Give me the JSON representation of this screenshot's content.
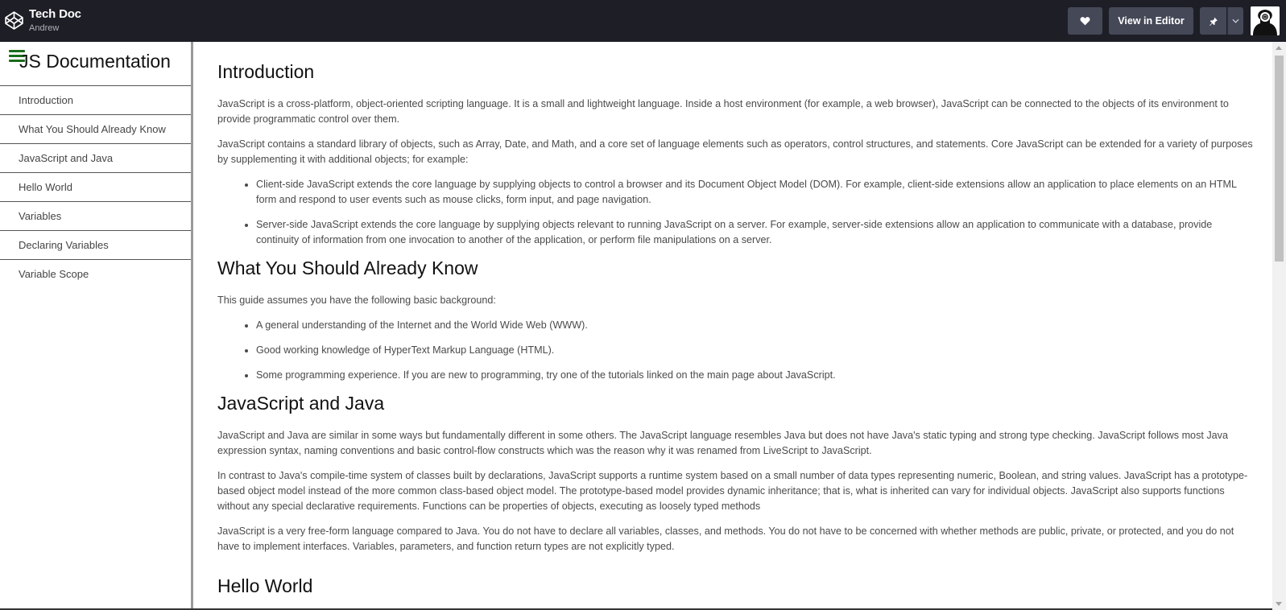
{
  "topbar": {
    "brand_title": "Tech Doc",
    "brand_user": "Andrew",
    "logo_icon": "codepen-logo-icon",
    "heart_icon": "heart-icon",
    "view_in_editor_label": "View in Editor",
    "pin_icon": "pin-icon",
    "caret_icon": "chevron-down-icon",
    "avatar_icon": "user-avatar-icon"
  },
  "sidebar": {
    "title": "JS Documentation",
    "menu_icon": "hamburger-menu-icon",
    "items": [
      {
        "label": "Introduction"
      },
      {
        "label": "What You Should Already Know"
      },
      {
        "label": "JavaScript and Java"
      },
      {
        "label": "Hello World"
      },
      {
        "label": "Variables"
      },
      {
        "label": "Declaring Variables"
      },
      {
        "label": "Variable Scope"
      }
    ]
  },
  "main": {
    "sections": [
      {
        "title": "Introduction",
        "paragraphs": [
          "JavaScript is a cross-platform, object-oriented scripting language. It is a small and lightweight language. Inside a host environment (for example, a web browser), JavaScript can be connected to the objects of its environment to provide programmatic control over them.",
          "JavaScript contains a standard library of objects, such as Array, Date, and Math, and a core set of language elements such as operators, control structures, and statements. Core JavaScript can be extended for a variety of purposes by supplementing it with additional objects; for example:"
        ],
        "bullets": [
          "Client-side JavaScript extends the core language by supplying objects to control a browser and its Document Object Model (DOM). For example, client-side extensions allow an application to place elements on an HTML form and respond to user events such as mouse clicks, form input, and page navigation.",
          "Server-side JavaScript extends the core language by supplying objects relevant to running JavaScript on a server. For example, server-side extensions allow an application to communicate with a database, provide continuity of information from one invocation to another of the application, or perform file manipulations on a server."
        ]
      },
      {
        "title": "What You Should Already Know",
        "paragraphs": [
          "This guide assumes you have the following basic background:"
        ],
        "bullets": [
          "A general understanding of the Internet and the World Wide Web (WWW).",
          "Good working knowledge of HyperText Markup Language (HTML).",
          "Some programming experience. If you are new to programming, try one of the tutorials linked on the main page about JavaScript."
        ]
      },
      {
        "title": "JavaScript and Java",
        "paragraphs": [
          "JavaScript and Java are similar in some ways but fundamentally different in some others. The JavaScript language resembles Java but does not have Java's static typing and strong type checking. JavaScript follows most Java expression syntax, naming conventions and basic control-flow constructs which was the reason why it was renamed from LiveScript to JavaScript.",
          "In contrast to Java's compile-time system of classes built by declarations, JavaScript supports a runtime system based on a small number of data types representing numeric, Boolean, and string values. JavaScript has a prototype-based object model instead of the more common class-based object model. The prototype-based model provides dynamic inheritance; that is, what is inherited can vary for individual objects. JavaScript also supports functions without any special declarative requirements. Functions can be properties of objects, executing as loosely typed methods",
          "JavaScript is a very free-form language compared to Java. You do not have to declare all variables, classes, and methods. You do not have to be concerned with whether methods are public, private, or protected, and you do not have to implement interfaces. Variables, parameters, and function return types are not explicitly typed."
        ],
        "bullets": []
      },
      {
        "title": "Hello World",
        "paragraphs": [],
        "bullets": []
      }
    ]
  },
  "colors": {
    "topbar_bg": "#1e1f26",
    "button_bg": "#444857",
    "menu_icon": "#1a6b1a",
    "text": "#4a4a4a"
  }
}
